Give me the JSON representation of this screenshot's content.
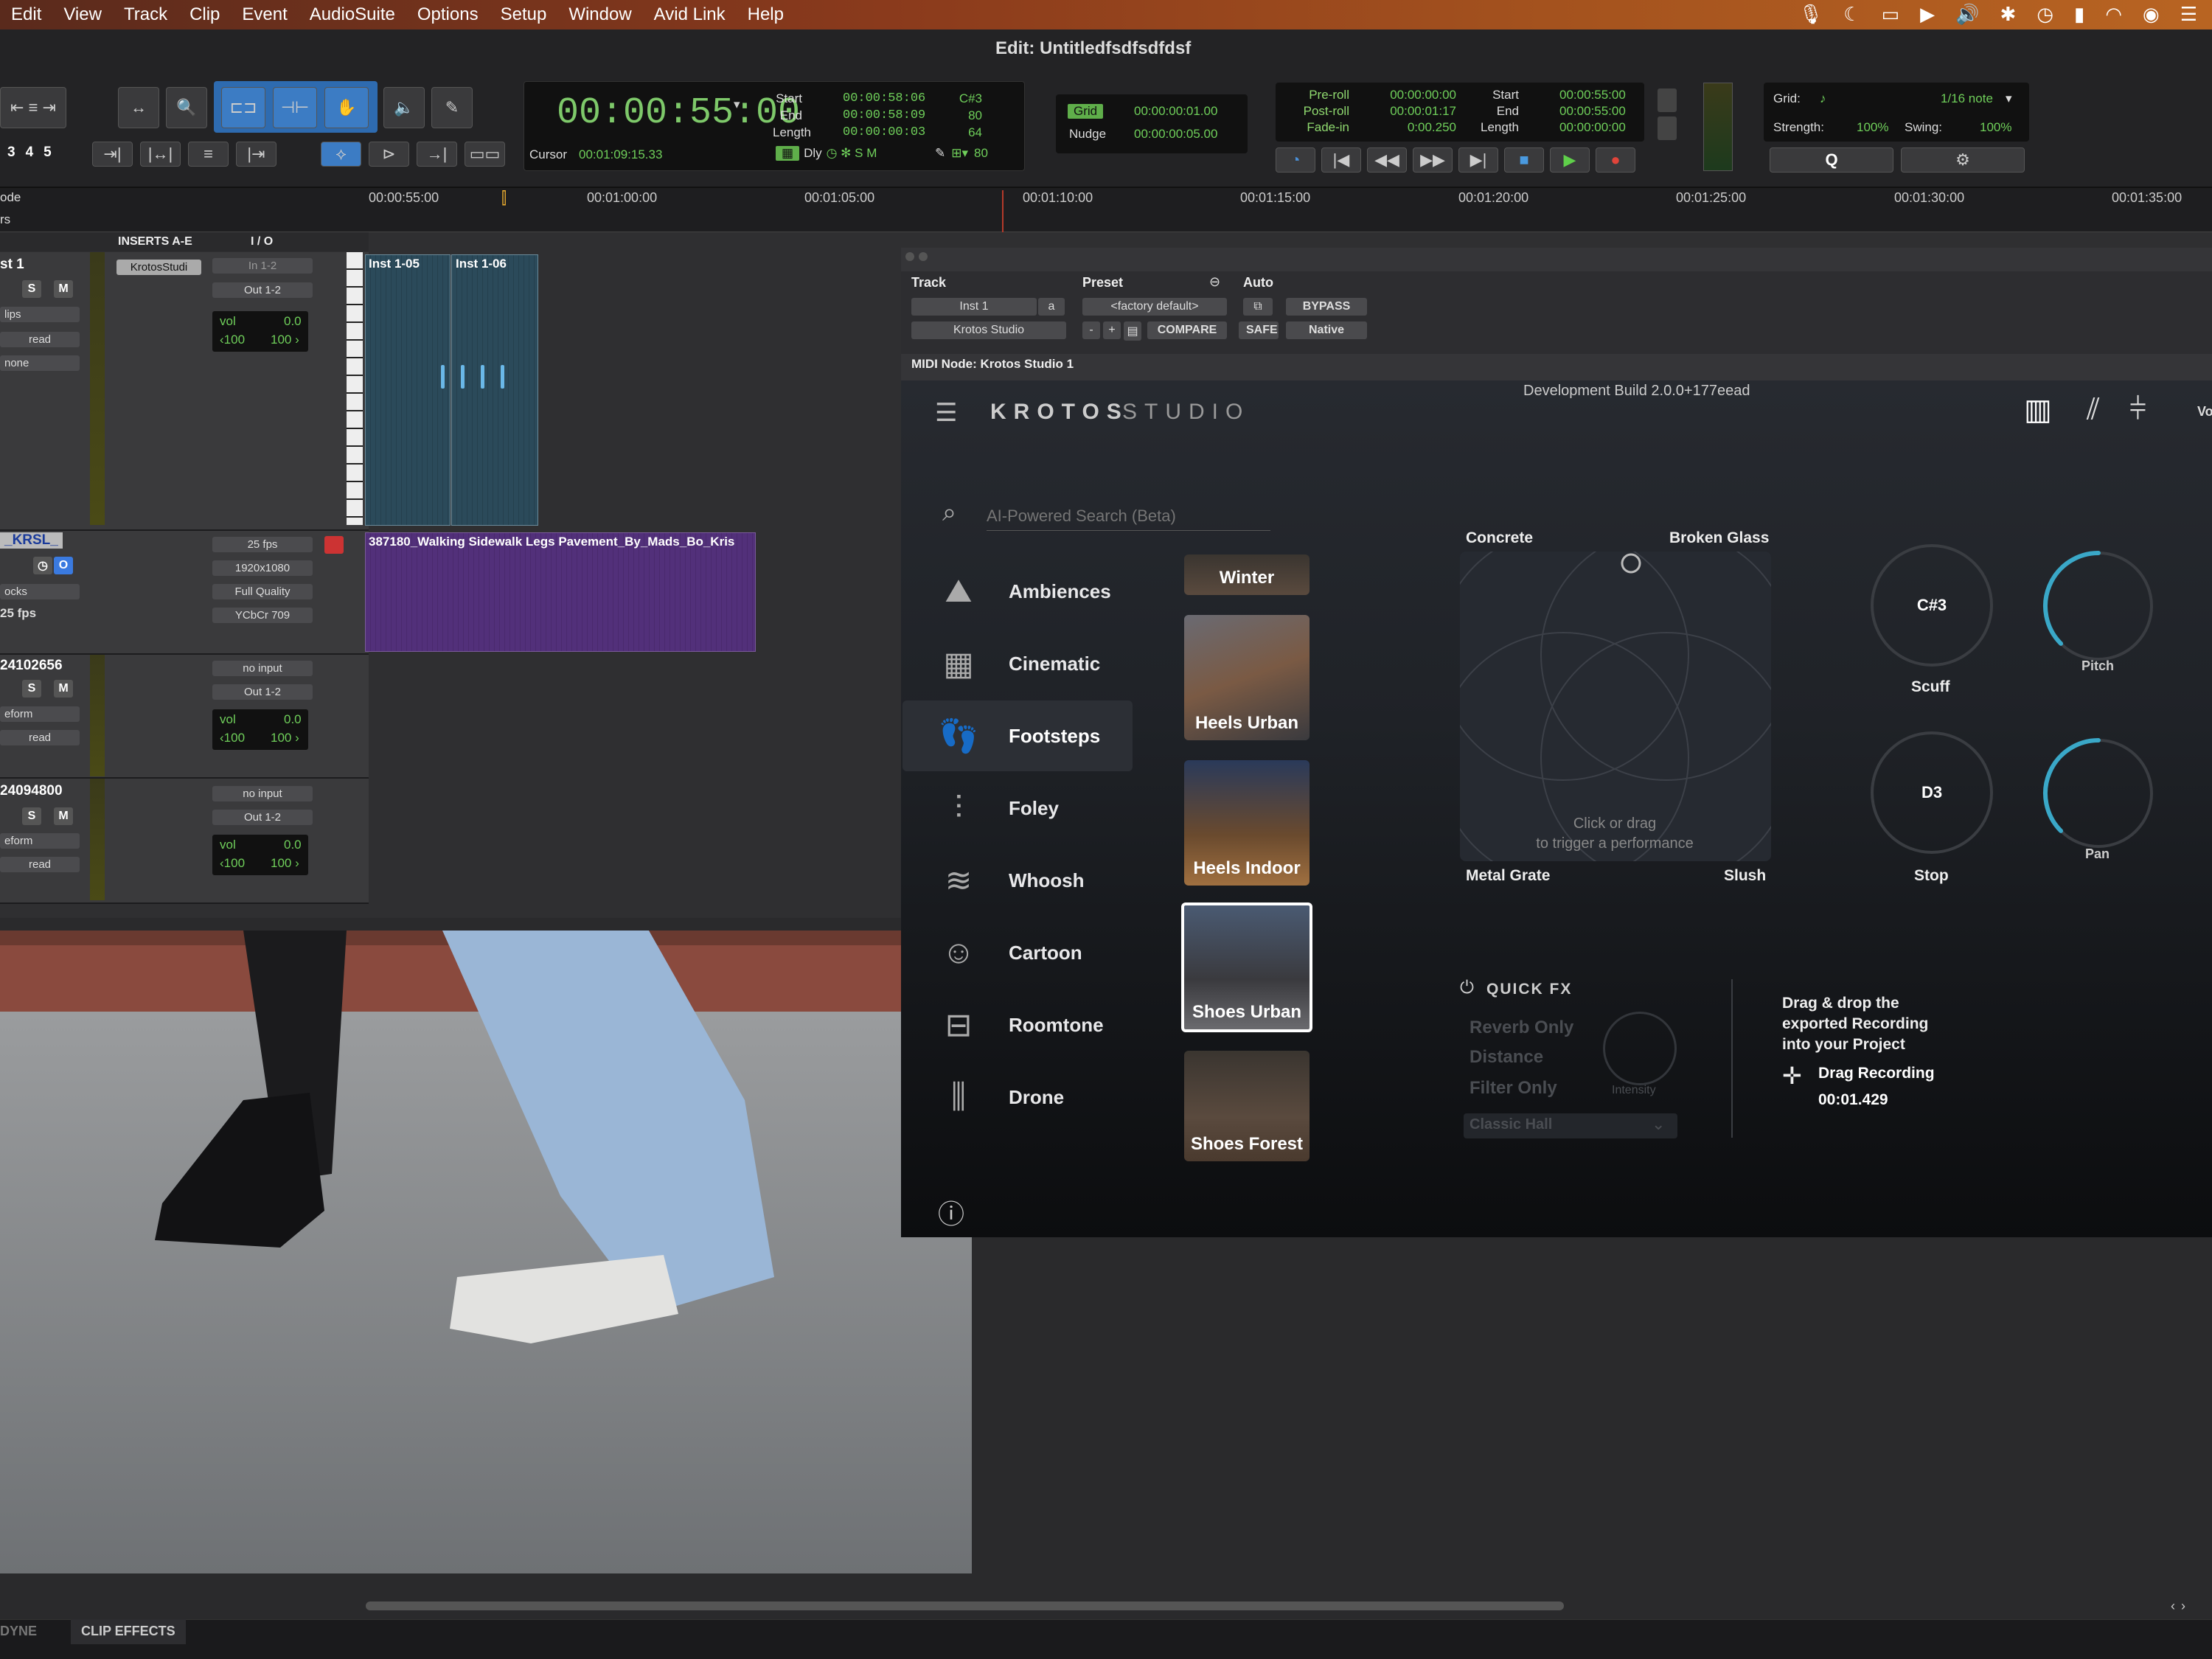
{
  "menubar": {
    "items": [
      "Edit",
      "View",
      "Track",
      "Clip",
      "Event",
      "AudioSuite",
      "Options",
      "Setup",
      "Window",
      "Avid Link",
      "Help"
    ]
  },
  "window_title": "Edit: Untitledfsdfsdfdsf",
  "counter": {
    "main_time": "00:00:55:00",
    "start_label": "Start",
    "start": "00:00:58:06",
    "end_label": "End",
    "end": "00:00:58:09",
    "length_label": "Length",
    "length": "00:00:00:03",
    "note": "C#3",
    "velocity1": "80",
    "velocity2": "64",
    "cursor_label": "Cursor",
    "cursor": "00:01:09:15.33",
    "dly_label": "Dly",
    "tempo": "80"
  },
  "grid": {
    "grid_label": "Grid",
    "grid_value": "00:00:00:01.00",
    "nudge_label": "Nudge",
    "nudge_value": "00:00:00:05.00"
  },
  "preroll": {
    "preroll_label": "Pre-roll",
    "preroll": "00:00:00:00",
    "postroll_label": "Post-roll",
    "postroll": "00:00:01:17",
    "fadein_label": "Fade-in",
    "fadein": "0:00.250",
    "start_label": "Start",
    "start": "00:00:55:00",
    "end_label": "End",
    "end": "00:00:55:00",
    "length_label": "Length",
    "length": "00:00:00:00"
  },
  "midi_grid": {
    "grid_label": "Grid:",
    "grid_value": "1/16 note",
    "strength_label": "Strength:",
    "strength": "100%",
    "swing_label": "Swing:",
    "swing": "100%",
    "q_label": "Q"
  },
  "ruler": {
    "mode_label": "ode",
    "row2_label": "rs",
    "ticks": [
      "00:00:55:00",
      "00:01:00:00",
      "00:01:05:00",
      "00:01:10:00",
      "00:01:15:00",
      "00:01:20:00",
      "00:01:25:00",
      "00:01:30:00",
      "00:01:35:00"
    ]
  },
  "tracks": {
    "inserts_header": "INSERTS A-E",
    "io_header": "I / O",
    "numbers": [
      "3",
      "4",
      "5"
    ],
    "t1": {
      "name": "st 1",
      "insert": "KrotosStudi",
      "in": "In 1-2",
      "out": "Out 1-2",
      "mode": "lips",
      "automation": "read",
      "group": "none",
      "vol_label": "vol",
      "vol": "0.0",
      "pan_l": "‹100",
      "pan_r": "100 ›"
    },
    "t2": {
      "name": "_KRSL_",
      "fps": "25 fps",
      "res": "1920x1080",
      "quality": "Full Quality",
      "color": "YCbCr 709",
      "mode": "ocks",
      "fps_small": "25 fps"
    },
    "t3": {
      "name": "24102656",
      "in": "no input",
      "out": "Out 1-2",
      "mode": "eform",
      "automation": "read",
      "vol_label": "vol",
      "vol": "0.0",
      "pan_l": "‹100",
      "pan_r": "100 ›"
    },
    "t4": {
      "name": "24094800",
      "in": "no input",
      "out": "Out 1-2",
      "mode": "eform",
      "automation": "read",
      "vol_label": "vol",
      "vol": "0.0",
      "pan_l": "‹100",
      "pan_r": "100 ›"
    },
    "clips": {
      "inst1": "Inst 1-05",
      "inst2": "Inst 1-06",
      "video": "387180_Walking Sidewalk Legs Pavement_By_Mads_Bo_Kris"
    },
    "s_label": "S",
    "m_label": "M"
  },
  "plugin": {
    "track_label": "Track",
    "preset_label": "Preset",
    "auto_label": "Auto",
    "track_value": "Inst 1",
    "track_letter": "a",
    "preset_value": "<factory default>",
    "bypass": "BYPASS",
    "plugin_name": "Krotos Studio",
    "minus": "-",
    "plus": "+",
    "compare": "COMPARE",
    "safe": "SAFE",
    "native": "Native",
    "midi_node": "MIDI Node: Krotos Studio 1"
  },
  "krotos": {
    "build": "Development Build 2.0.0+177eead",
    "logo_a": "KROTOS",
    "logo_b": "STUDIO",
    "search_placeholder": "AI-Powered Search (Beta)",
    "vol_cut": "Vo",
    "categories": [
      "Ambiences",
      "Cinematic",
      "Footsteps",
      "Foley",
      "Whoosh",
      "Cartoon",
      "Roomtone",
      "Drone"
    ],
    "selected_category": "Footsteps",
    "presets": [
      "Winter",
      "Heels Urban",
      "Heels Indoor",
      "Shoes Urban",
      "Shoes Forest"
    ],
    "selected_preset": "Shoes Urban",
    "xy": {
      "tl": "Concrete",
      "tr": "Broken Glass",
      "bl": "Metal Grate",
      "br": "Slush",
      "hint1": "Click or drag",
      "hint2": "to trigger a performance"
    },
    "knobs": {
      "k1_note": "C#3",
      "k1_label": "Scuff",
      "k2_note": "D3",
      "k2_label": "Stop",
      "pitch": "Pitch",
      "pan": "Pan",
      "pitch_level": 0.2,
      "pan_level": 0.2
    },
    "quickfx": {
      "title": "QUICK FX",
      "items": [
        "Reverb Only",
        "Distance",
        "Filter Only"
      ],
      "intensity": "Intensity",
      "reverb_type": "Classic Hall"
    },
    "drag": {
      "line1": "Drag & drop the",
      "line2": "exported Recording",
      "line3": "into your Project",
      "button": "Drag Recording",
      "time": "00:01.429"
    }
  },
  "bottom": {
    "tab1": "DYNE",
    "tab2": "CLIP EFFECTS"
  }
}
